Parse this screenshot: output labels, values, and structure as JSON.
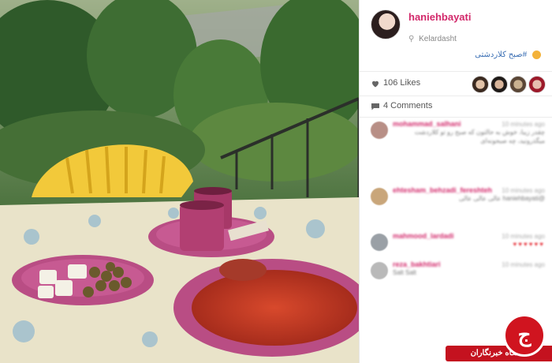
{
  "post": {
    "username": "haniehbayati",
    "location": "Kelardasht",
    "caption": "#صبح کلاردشتی"
  },
  "likes": {
    "label": "106 Likes"
  },
  "comments_summary": {
    "label": "4 Comments"
  },
  "comments": [
    {
      "user": "mohammad_salhani",
      "time": "10 minutes ago",
      "text": "چقدر زیبا، خوش به حالتون که صبح رو تو کلاردشت میگذرونید، چه صبحونه‌ای"
    },
    {
      "user": "ehtesham_behzadi_fereshteh",
      "time": "10 minutes ago",
      "text": "@haniehbayati عالی عالی عالی"
    },
    {
      "user": "mahmood_lardadi",
      "time": "10 minutes ago",
      "text": ""
    },
    {
      "user": "reza_bakhtiari",
      "time": "10 minutes ago",
      "text": "Salt Salt",
      "ltr": true
    }
  ],
  "watermark": {
    "label": "باشگاه خبرنگاران",
    "glyph": "ج"
  },
  "icons": {
    "location": "location-pin-icon",
    "like": "heart-icon",
    "comment": "speech-bubble-icon"
  },
  "colors": {
    "username": "#d2286a",
    "hashtag": "#3b6fb4",
    "watermark": "#c4121f"
  }
}
